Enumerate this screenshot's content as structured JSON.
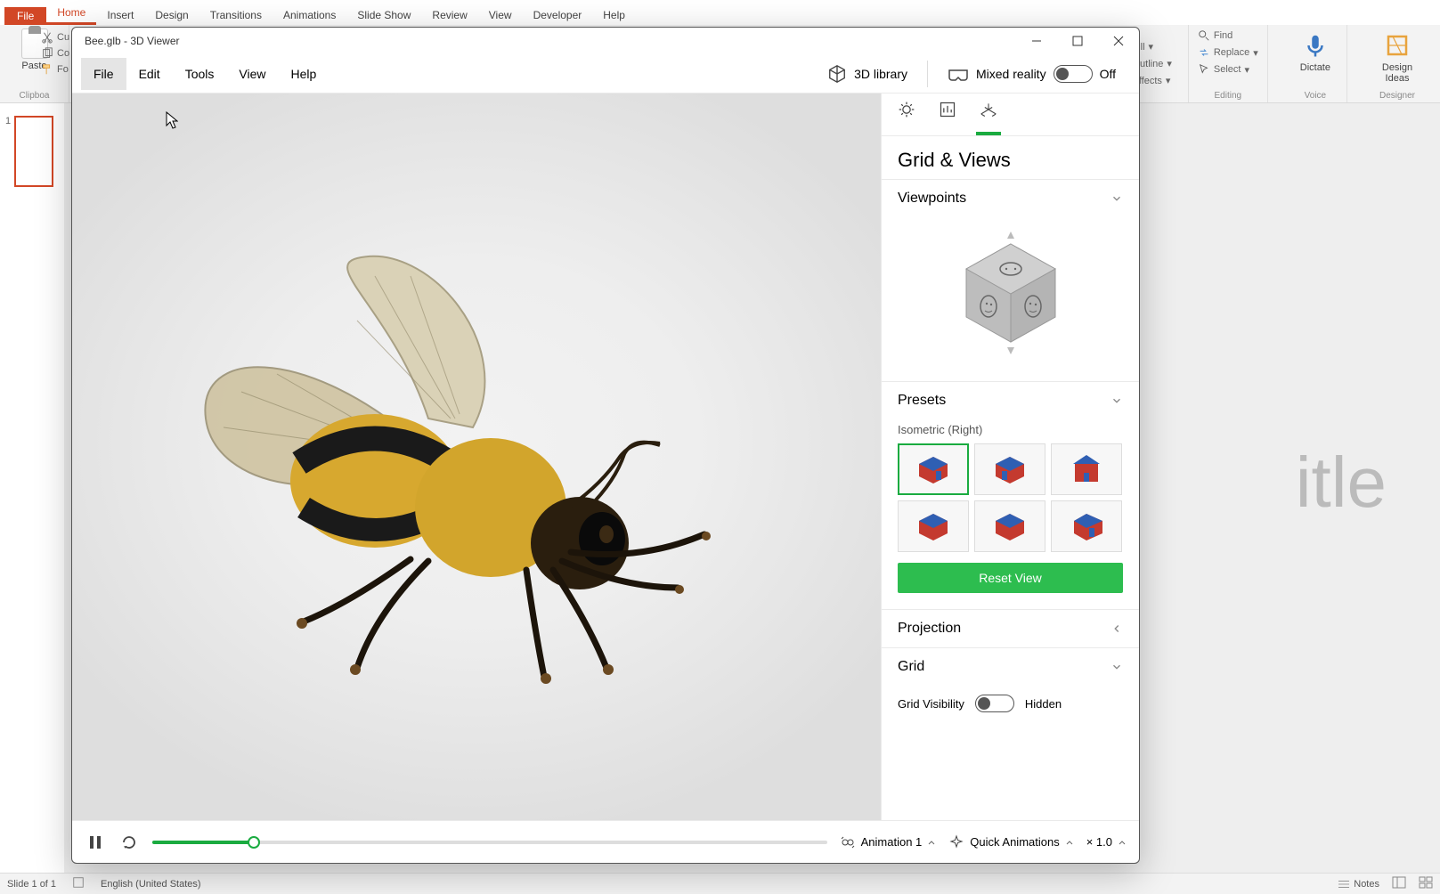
{
  "powerpoint": {
    "tabs": [
      "File",
      "Home",
      "Insert",
      "Design",
      "Transitions",
      "Animations",
      "Slide Show",
      "Review",
      "View",
      "Developer",
      "Help"
    ],
    "active_tab": "Home",
    "clipboard": {
      "paste": "Paste",
      "cut": "Cu",
      "copy": "Co",
      "format": "Fo",
      "group": "Clipboa"
    },
    "shape": {
      "fill": "Shape Fill",
      "outline": "Shape Outline",
      "effects": "Shape Effects"
    },
    "editing": {
      "find": "Find",
      "replace": "Replace",
      "select": "Select",
      "group": "Editing"
    },
    "voice": {
      "dictate": "Dictate",
      "group": "Voice"
    },
    "designer": {
      "ideas": "Design Ideas",
      "group": "Designer"
    },
    "slide_title_ghost": "itle",
    "slide_number": "1",
    "status": {
      "slide": "Slide 1 of 1",
      "lang": "English (United States)",
      "notes": "Notes"
    }
  },
  "viewer": {
    "title": "Bee.glb - 3D Viewer",
    "menus": [
      "File",
      "Edit",
      "Tools",
      "View",
      "Help"
    ],
    "hover_menu_index": 0,
    "library": "3D library",
    "mixed_reality": "Mixed reality",
    "mr_state": "Off",
    "side": {
      "heading": "Grid & Views",
      "viewpoints": "Viewpoints",
      "presets": "Presets",
      "preset_label": "Isometric (Right)",
      "reset": "Reset View",
      "projection": "Projection",
      "grid": "Grid",
      "grid_visibility": "Grid Visibility",
      "grid_state": "Hidden"
    },
    "footer": {
      "animation": "Animation 1",
      "quick": "Quick Animations",
      "speed": "× 1.0"
    }
  },
  "chart_data": null
}
